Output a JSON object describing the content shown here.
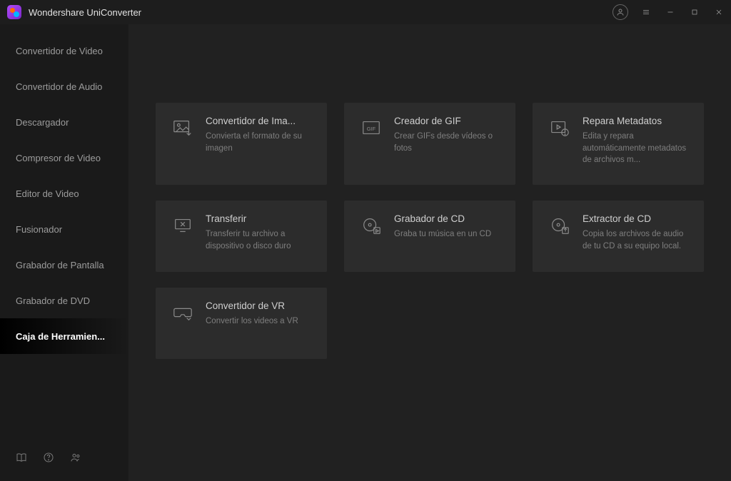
{
  "titlebar": {
    "title": "Wondershare UniConverter"
  },
  "sidebar": {
    "items": [
      {
        "label": "Convertidor de Video"
      },
      {
        "label": "Convertidor de Audio"
      },
      {
        "label": "Descargador"
      },
      {
        "label": "Compresor de Video"
      },
      {
        "label": "Editor de Video"
      },
      {
        "label": "Fusionador"
      },
      {
        "label": "Grabador de Pantalla"
      },
      {
        "label": "Grabador de DVD"
      },
      {
        "label": "Caja de Herramien..."
      }
    ]
  },
  "cards": [
    {
      "title": "Convertidor de Ima...",
      "desc": "Convierta el formato de su imagen"
    },
    {
      "title": "Creador de GIF",
      "desc": "Crear GIFs desde vídeos o fotos"
    },
    {
      "title": "Repara Metadatos",
      "desc": "Edita y repara automáticamente metadatos de archivos m..."
    },
    {
      "title": "Transferir",
      "desc": "Transferir tu archivo a dispositivo o disco duro"
    },
    {
      "title": "Grabador de CD",
      "desc": "Graba tu música en un CD"
    },
    {
      "title": "Extractor de CD",
      "desc": "Copia los archivos de audio de tu CD a su equipo local."
    },
    {
      "title": "Convertidor de VR",
      "desc": "Convertir los videos a VR"
    }
  ]
}
